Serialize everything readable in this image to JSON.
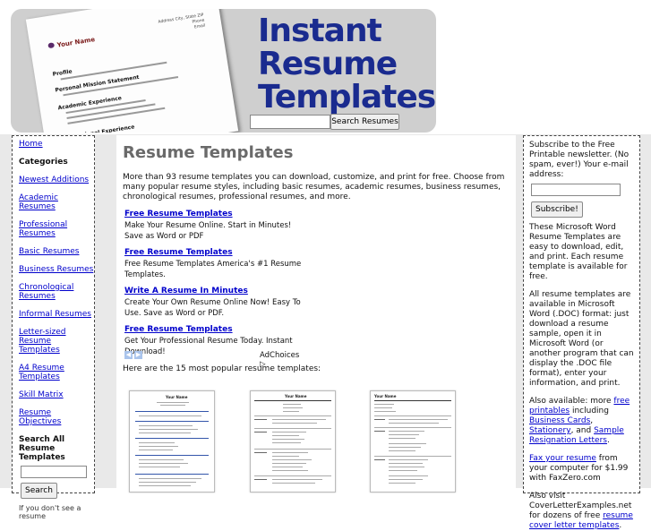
{
  "header": {
    "logo_lines": [
      "Instant",
      "Resume",
      "Templates"
    ],
    "search_button": "Search Resumes",
    "paper": {
      "name": "Your Name",
      "address_lines": [
        "Address City, State ZIP",
        "Phone",
        "Email"
      ],
      "sections": [
        "Profile",
        "Personal Mission Statement",
        "Academic Experience",
        "Professional Experience"
      ]
    }
  },
  "left": {
    "home": "Home",
    "categories_heading": "Categories",
    "items": [
      "Newest Additions",
      "Academic Resumes",
      "Professional Resumes",
      "Basic Resumes",
      "Business Resumes",
      "Chronological Resumes",
      "Informal Resumes",
      "Letter-sized Resume Templates",
      "A4 Resume Templates",
      "Skill Matrix",
      "Resume Objectives"
    ],
    "search_heading": "Search All Resume Templates",
    "search_button": "Search",
    "cut_text": "If you don't see a resume"
  },
  "main": {
    "title": "Resume Templates",
    "intro": "More than 93 resume templates you can download, customize, and print for free. Choose from many popular resume styles, including basic resumes, academic resumes, business resumes, chronological resumes, professional resumes, and more.",
    "ads": [
      {
        "title": "Free Resume Templates",
        "desc": "Make Your Resume Online. Start in Minutes! Save as Word or PDF"
      },
      {
        "title": "Free Resume Templates",
        "desc": "Free Resume Templates America's #1 Resume Templates."
      },
      {
        "title": "Write A Resume In Minutes",
        "desc": "Create Your Own Resume Online Now! Easy To Use. Save as Word or PDF."
      },
      {
        "title": "Free Resume Templates",
        "desc": "Get Your Professional Resume Today. Instant Download!"
      }
    ],
    "adchoices": "AdChoices ▷",
    "popular_text": "Here are the 15 most popular resume templates:",
    "thumbnails": [
      {
        "caption": "Your Name"
      },
      {
        "caption": "Your Name"
      },
      {
        "caption": "Your Name"
      }
    ]
  },
  "right": {
    "subscribe_text": "Subscribe to the Free Printable newsletter. (No spam, ever!) Your e-mail address:",
    "subscribe_button": "Subscribe!",
    "p1": "These Microsoft Word Resume Templates are easy to download, edit, and print. Each resume template is available for free.",
    "p2": "All resume templates are available in Microsoft Word (.DOC) format: just download a resume sample, open it in Microsoft Word (or another program that can display the .DOC file format), enter your information, and print.",
    "p3_pre": "Also available: more ",
    "p3_link1": "free printables",
    "p3_mid1": " including ",
    "p3_link2": "Business Cards",
    "p3_mid2": ", ",
    "p3_link3": "Stationery",
    "p3_mid3": ", and ",
    "p3_link4": "Sample Resignation Letters",
    "p3_end": ".",
    "p4_link": "Fax your resume",
    "p4_text": " from your computer for $1.99 with FaxZero.com",
    "p5_pre": "Also visit CoverLetterExamples.net for dozens of free ",
    "p5_link": "resume cover letter templates",
    "p5_end": "."
  }
}
